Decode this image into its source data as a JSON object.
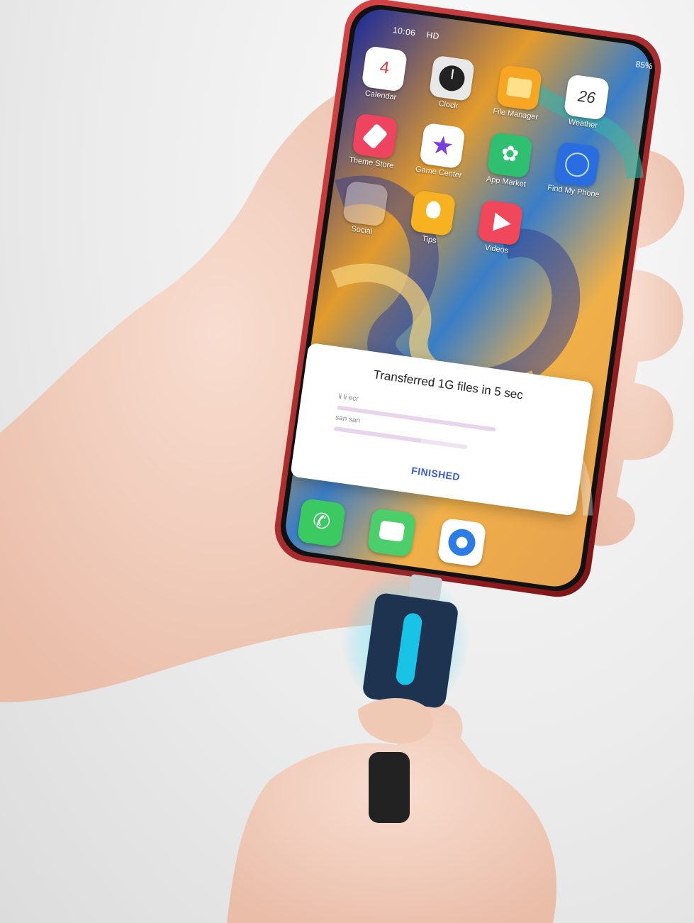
{
  "status_bar": {
    "time": "10:06",
    "network": "HD",
    "battery": "85%"
  },
  "apps": [
    {
      "label": "Calendar",
      "icon": "calendar-icon",
      "badge": "4"
    },
    {
      "label": "Clock",
      "icon": "clock-icon"
    },
    {
      "label": "File Manager",
      "icon": "folder-icon"
    },
    {
      "label": "Weather",
      "icon": "weather-icon",
      "badge": "26"
    },
    {
      "label": "Theme Store",
      "icon": "brush-icon"
    },
    {
      "label": "Game Center",
      "icon": "star-icon"
    },
    {
      "label": "App Market",
      "icon": "clover-icon"
    },
    {
      "label": "Find My Phone",
      "icon": "radar-icon"
    },
    {
      "label": "Social",
      "icon": "folder-social-icon"
    },
    {
      "label": "Tips",
      "icon": "lightbulb-icon"
    },
    {
      "label": "Videos",
      "icon": "play-icon"
    }
  ],
  "dialog": {
    "title": "Transferred 1G files in 5 sec",
    "row1_label": "li li ecr",
    "row2_label": "san san",
    "progress1": 1.0,
    "progress2": 0.65,
    "button": "FINISHED"
  },
  "dock": [
    {
      "icon": "phone-icon"
    },
    {
      "icon": "messages-icon"
    },
    {
      "icon": "browser-icon"
    }
  ],
  "colors": {
    "phone_frame": "#b0262a",
    "accent": "#3a5bd8",
    "otg_body": "#1e3350",
    "otg_light": "#19c3e6"
  }
}
